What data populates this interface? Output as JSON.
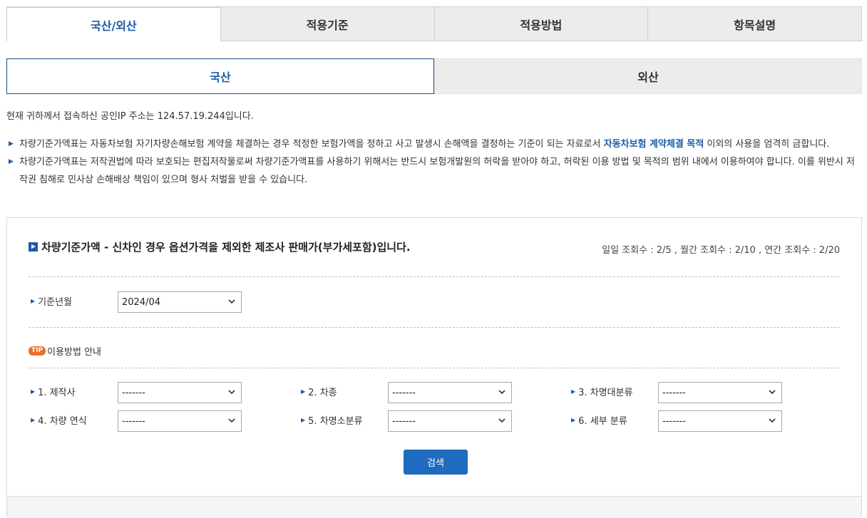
{
  "tabs": [
    "국산/외산",
    "적용기준",
    "적용방법",
    "항목설명"
  ],
  "subtabs": [
    "국산",
    "외산"
  ],
  "ip_notice": "현재 귀하께서 접속하신 공인IP 주소는 124.57.19.244입니다.",
  "notice1": {
    "pre": "차량기준가액표는 자동차보험 자기차량손해보험 계약을 체결하는 경우 적정한 보험가액을 정하고 사고 발생시 손해액을 결정하는 기준이 되는 자료로서 ",
    "highlight": "자동차보험 계약체결 목적",
    "post": " 이외의 사용을 엄격히 금합니다."
  },
  "notice2": "차량기준가액표는 저작권법에 따라 보호되는 편집저작물로써 차량기준가액표를 사용하기 위해서는 반드시 보험개발원의 허락을 받아야 하고, 허락된 이용 방법 및 목적의 범위 내에서 이용하여야 합니다. 이를 위반시 저작권 침해로 민사상 손해배상 책임이 있으며 형사 처벌을 받을 수 있습니다.",
  "panel": {
    "title": "차량기준가액 - 신차인 경우 옵션가격을 제외한 제조사 판매가(부가세포함)입니다.",
    "counts": "일일 조회수 : 2/5 , 월간 조회수 : 2/10 , 연간 조회수 : 2/20",
    "base_month_label": "기준년월",
    "base_month_value": "2024/04",
    "tip_badge": "TIP",
    "tip_text": "이용방법 안내",
    "fields": [
      {
        "label": "1. 제작사",
        "value": "-------"
      },
      {
        "label": "2. 차종",
        "value": "-------"
      },
      {
        "label": "3. 차명대분류",
        "value": "-------"
      },
      {
        "label": "4. 차량 연식",
        "value": "-------"
      },
      {
        "label": "5. 차명소분류",
        "value": "-------"
      },
      {
        "label": "6. 세부 분류",
        "value": "-------"
      }
    ],
    "search_label": "검색"
  }
}
